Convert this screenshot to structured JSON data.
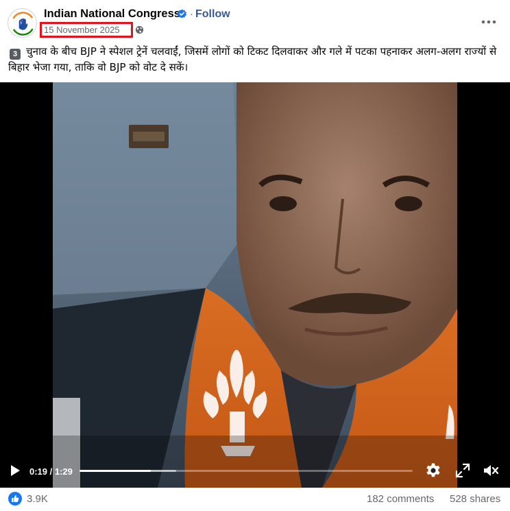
{
  "post": {
    "page_name": "Indian National Congress",
    "follow_label": "Follow",
    "separator": "·",
    "date": "15 November 2025",
    "audience_icon": "globe-icon",
    "verified_icon": "verified-badge-icon",
    "more_icon": "more-options-icon",
    "number_badge": "3",
    "caption_text": "चुनाव के बीच BJP ने स्पेशल ट्रेनें चलवाईं, जिसमें लोगों को टिकट दिलवाकर और गले में पटका पहनाकर अलग-अलग राज्यों से बिहार भेजा गया, ताकि वो BJP को वोट दे सकें।"
  },
  "video": {
    "current_time": "0:19",
    "duration": "1:29",
    "time_display": "0:19 / 1:29",
    "progress_fraction": 0.213,
    "buffer_fraction": 0.29,
    "icons": [
      "play-icon",
      "settings-gear-icon",
      "fullscreen-icon",
      "mute-icon"
    ]
  },
  "reactions": {
    "like_count": "3.9K",
    "comments": "182 comments",
    "shares": "528 shares"
  },
  "colors": {
    "follow_blue": "#385898",
    "highlight_red": "#e0131f",
    "like_blue": "#1877f2",
    "scarf_orange": "#e8701e"
  }
}
